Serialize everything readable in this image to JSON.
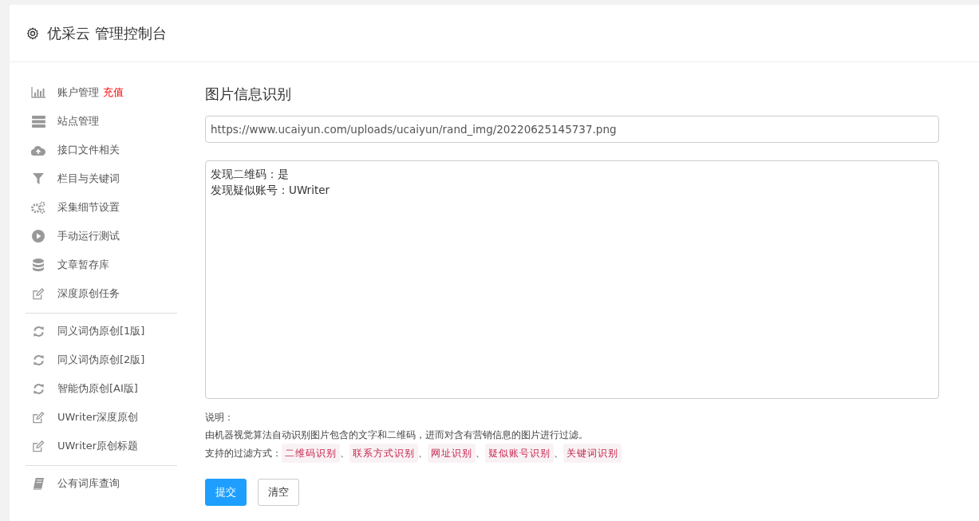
{
  "header": {
    "title": "优采云 管理控制台"
  },
  "sidebar": {
    "groups": [
      [
        {
          "label": "账户管理",
          "badge": "充值"
        },
        {
          "label": "站点管理"
        },
        {
          "label": "接口文件相关"
        },
        {
          "label": "栏目与关键词"
        },
        {
          "label": "采集细节设置"
        },
        {
          "label": "手动运行测试"
        },
        {
          "label": "文章暂存库"
        },
        {
          "label": "深度原创任务"
        }
      ],
      [
        {
          "label": "同义词伪原创[1版]"
        },
        {
          "label": "同义词伪原创[2版]"
        },
        {
          "label": "智能伪原创[AI版]"
        },
        {
          "label": "UWriter深度原创"
        },
        {
          "label": "UWriter原创标题"
        }
      ],
      [
        {
          "label": "公有词库查询"
        }
      ]
    ]
  },
  "main": {
    "heading": "图片信息识别",
    "url_field": {
      "value": "https://www.ucaiyun.com/uploads/ucaiyun/rand_img/20220625145737.png"
    },
    "result_box": {
      "lines": [
        "发现二维码：是",
        "发现疑似账号：UWriter"
      ]
    },
    "note_title": "说明：",
    "note_text": "由机器视觉算法自动识别图片包含的文字和二维码，进而对含有营销信息的图片进行过滤。",
    "filters_label": "支持的过滤方式：",
    "filters": [
      "二维码识别",
      "联系方式识别",
      "网址识别",
      "疑似账号识别",
      "关键词识别"
    ],
    "separator": "、",
    "buttons": [
      {
        "label": "提交",
        "kind": "primary"
      },
      {
        "label": "清空",
        "kind": "default"
      }
    ]
  }
}
